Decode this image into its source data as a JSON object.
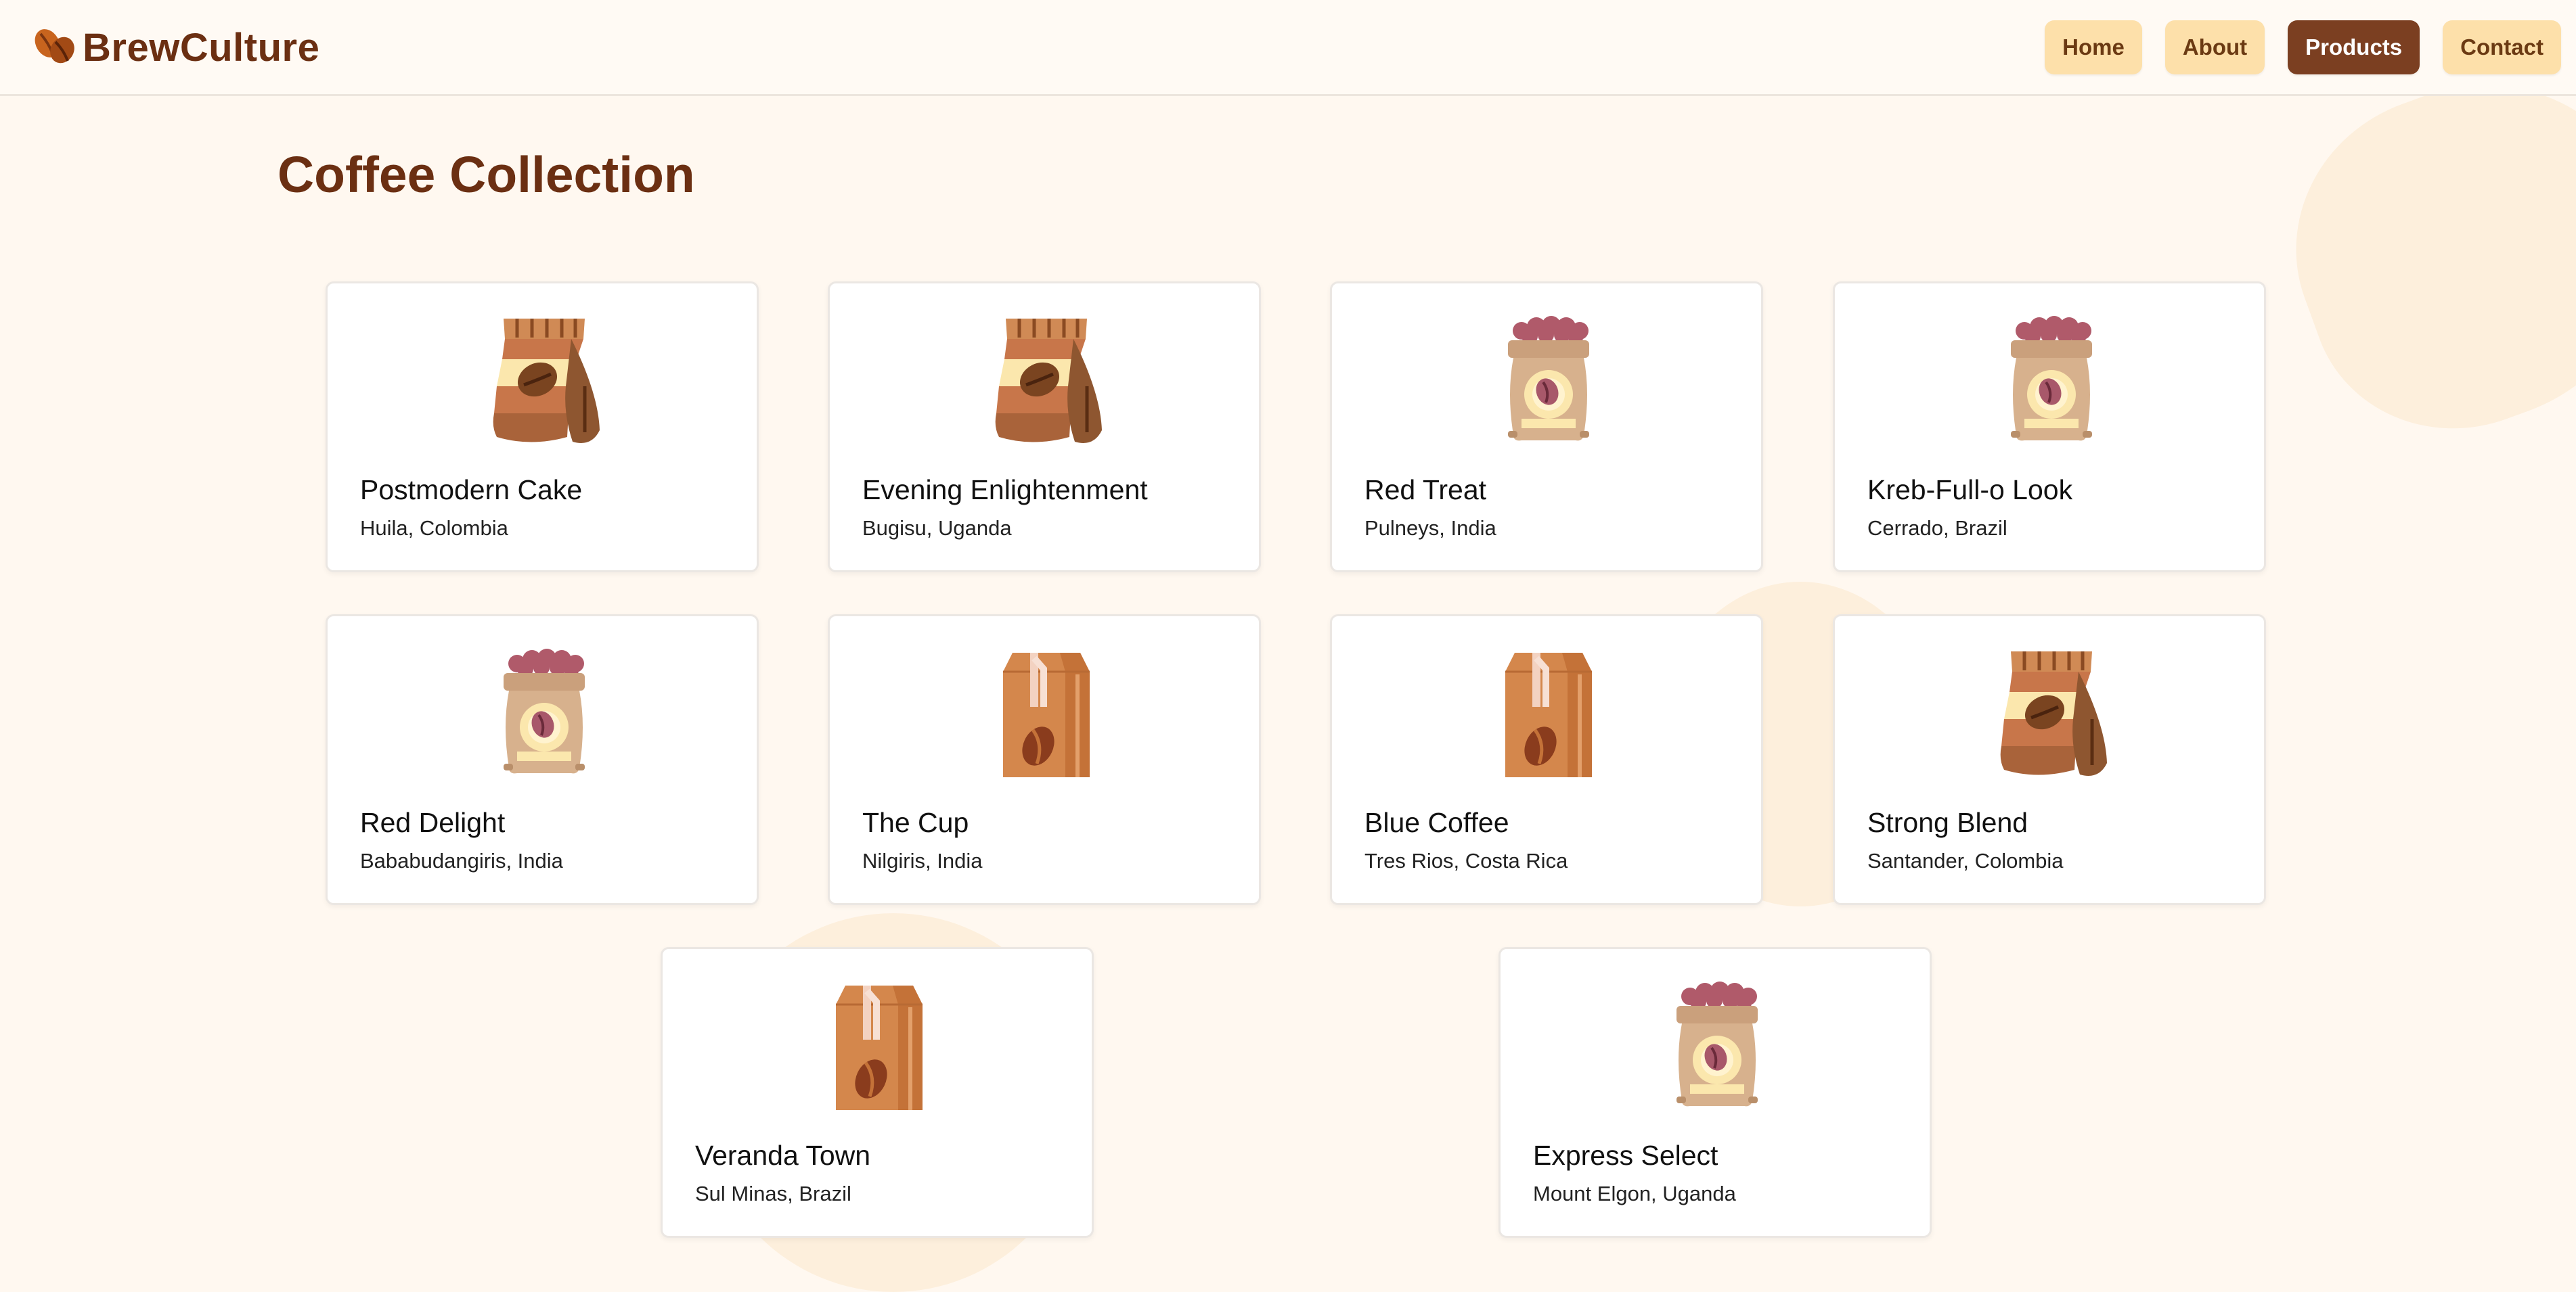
{
  "header": {
    "logo_text": "BrewCulture",
    "logo_icon": "coffee-beans-icon",
    "nav": [
      {
        "label": "Home",
        "active": false
      },
      {
        "label": "About",
        "active": false
      },
      {
        "label": "Products",
        "active": true
      },
      {
        "label": "Contact",
        "active": false
      }
    ]
  },
  "page": {
    "title": "Coffee Collection"
  },
  "products": [
    {
      "name": "Postmodern Cake",
      "origin": "Huila, Colombia",
      "icon": "striped-coffee-bag-icon"
    },
    {
      "name": "Evening Enlightenment",
      "origin": "Bugisu, Uganda",
      "icon": "striped-coffee-bag-icon"
    },
    {
      "name": "Red Treat",
      "origin": "Pulneys, India",
      "icon": "coffee-sack-icon"
    },
    {
      "name": "Kreb-Full-o Look",
      "origin": "Cerrado, Brazil",
      "icon": "coffee-sack-icon"
    },
    {
      "name": "Red Delight",
      "origin": "Bababudangiris, India",
      "icon": "coffee-sack-icon"
    },
    {
      "name": "The Cup",
      "origin": "Nilgiris, India",
      "icon": "coffee-box-icon"
    },
    {
      "name": "Blue Coffee",
      "origin": "Tres Rios, Costa Rica",
      "icon": "coffee-box-icon"
    },
    {
      "name": "Strong Blend",
      "origin": "Santander, Colombia",
      "icon": "striped-coffee-bag-icon"
    },
    {
      "name": "Veranda Town",
      "origin": "Sul Minas, Brazil",
      "icon": "coffee-box-icon"
    },
    {
      "name": "Express Select",
      "origin": "Mount Elgon, Uganda",
      "icon": "coffee-sack-icon"
    }
  ],
  "colors": {
    "brand": "#6b2f12",
    "nav_button": "#fde0aa",
    "nav_active": "#7b3f21",
    "background": "#fff8f0"
  }
}
